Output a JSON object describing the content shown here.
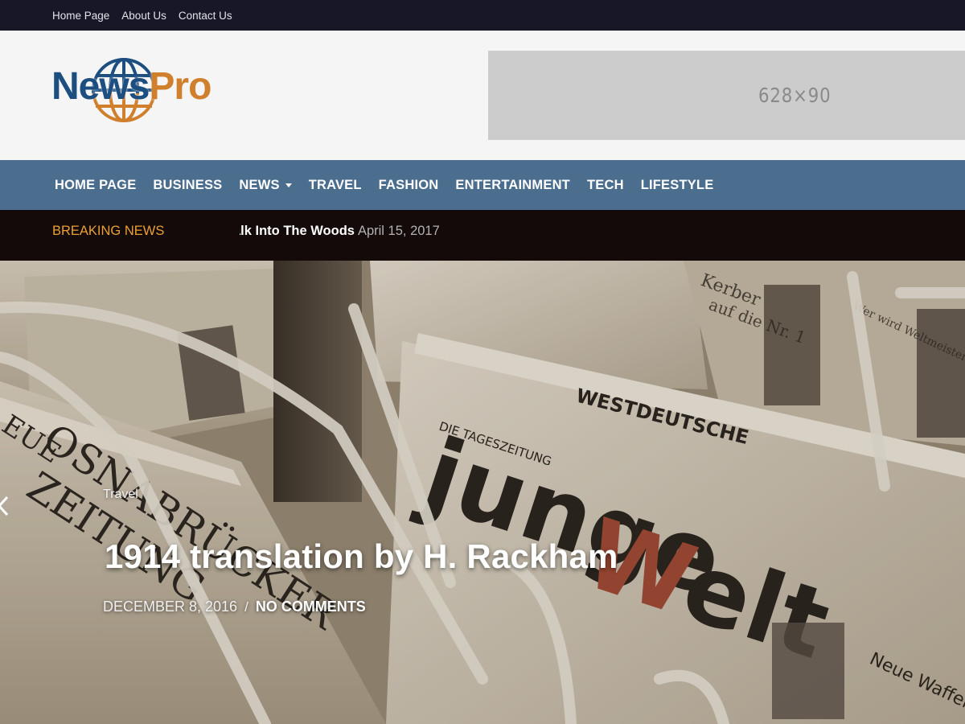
{
  "top_links": [
    "Home Page",
    "About Us",
    "Contact Us"
  ],
  "logo": {
    "text_news": "News",
    "text_pro": "Pro",
    "color_news": "#1c4e80",
    "color_pro": "#d07f2d"
  },
  "ad_slot": {
    "label": "628×90"
  },
  "nav": {
    "items": [
      {
        "label": "HOME PAGE",
        "dropdown": false
      },
      {
        "label": "BUSINESS",
        "dropdown": false
      },
      {
        "label": "NEWS",
        "dropdown": true
      },
      {
        "label": "TRAVEL",
        "dropdown": false
      },
      {
        "label": "FASHION",
        "dropdown": false
      },
      {
        "label": "ENTERTAINMENT",
        "dropdown": false
      },
      {
        "label": "TECH",
        "dropdown": false
      },
      {
        "label": "LIFESTYLE",
        "dropdown": false
      }
    ]
  },
  "breaking": {
    "label": "BREAKING NEWS",
    "ticker_title": "alk Into The Woods",
    "ticker_date": "April 15, 2017"
  },
  "hero": {
    "category": "Travel",
    "title": "1914 translation by H. Rackham",
    "date": "DECEMBER 8, 2016",
    "separator": "/",
    "comments": "NO COMMENTS",
    "prev_icon": "chevron-left-icon"
  },
  "colors": {
    "topbar_bg": "#181728",
    "header_bg": "#f5f5f5",
    "nav_bg": "#4b6d8e",
    "breaking_bg": "#130a09",
    "breaking_label": "#eba033",
    "ad_bg": "#cccccc"
  }
}
